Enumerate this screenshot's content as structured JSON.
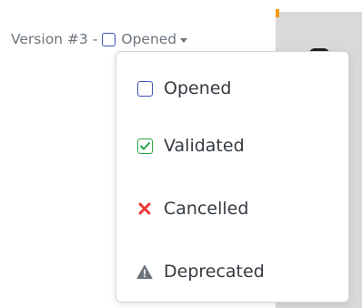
{
  "header": {
    "version_label": "Version #3",
    "separator": "-",
    "current_status": "Opened",
    "current_status_icon": "open-square-icon"
  },
  "status_menu": {
    "items": [
      {
        "label": "Opened",
        "icon": "open-square-icon",
        "color": "#3f51b5"
      },
      {
        "label": "Validated",
        "icon": "checked-square-icon",
        "color": "#28a745"
      },
      {
        "label": "Cancelled",
        "icon": "cross-icon",
        "color": "#e53935"
      },
      {
        "label": "Deprecated",
        "icon": "warning-triangle-icon",
        "color": "#6c757d"
      }
    ]
  },
  "colors": {
    "text": "#6c757d",
    "menu_text": "#343a40",
    "accent_orange": "#f39c12",
    "backdrop": "#d9d9d9"
  }
}
